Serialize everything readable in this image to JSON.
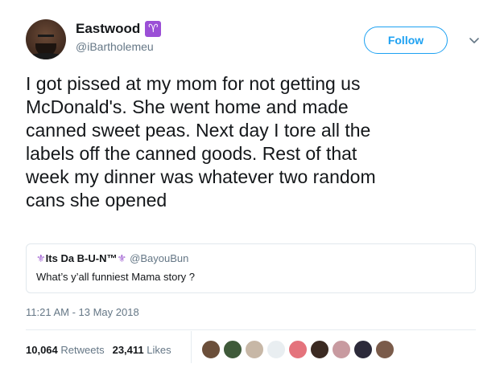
{
  "user": {
    "display_name": "Eastwood",
    "handle": "@iBartholemeu",
    "badge_glyph": "♈",
    "badge_color": "#9b4fd6"
  },
  "follow_label": "Follow",
  "tweet_text": "I got pissed at my mom for not getting us\nMcDonald's. She went home and made\ncanned sweet peas. Next day I tore all the\nlabels off the canned goods. Rest of that\nweek my dinner was whatever two random\ncans she opened",
  "quote": {
    "prefix_glyph": "⚜",
    "name": "Its Da B-U-N™",
    "suffix_glyph": "⚜",
    "handle": "@BayouBun",
    "text": "What’s y’all funniest Mama story ?"
  },
  "timestamp": "11:21 AM - 13 May 2018",
  "stats": {
    "retweets_count": "10,064",
    "retweets_label": "Retweets",
    "likes_count": "23,411",
    "likes_label": "Likes"
  },
  "likers": [
    {
      "name": "liker-1",
      "color": "#6b4f3a"
    },
    {
      "name": "liker-2",
      "color": "#3f5a3a"
    },
    {
      "name": "liker-3",
      "color": "#c7b7a6"
    },
    {
      "name": "liker-4",
      "color": "#e9eef1"
    },
    {
      "name": "liker-5",
      "color": "#e4737c"
    },
    {
      "name": "liker-6",
      "color": "#3b2a22"
    },
    {
      "name": "liker-7",
      "color": "#c89aa0"
    },
    {
      "name": "liker-8",
      "color": "#2c2a3a"
    },
    {
      "name": "liker-9",
      "color": "#7a5b4a"
    }
  ],
  "colors": {
    "accent": "#1da1f2",
    "muted_text": "#657786",
    "primary_text": "#14171a"
  }
}
